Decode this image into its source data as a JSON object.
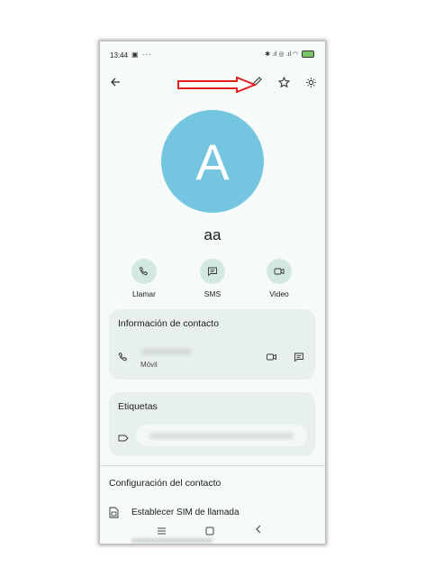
{
  "status_bar": {
    "time": "13:44",
    "notifications": "▣ ···",
    "system_icons": "✱ .ıl ◎ .ıl ◠"
  },
  "toolbar": {
    "back_icon": "arrow-left-icon",
    "edit_icon": "pencil-icon",
    "favorite_icon": "star-icon",
    "settings_icon": "contact-settings-icon",
    "annotation_color": "#e0201f"
  },
  "contact": {
    "avatar_letter": "A",
    "avatar_color": "#74c6e0",
    "name": "aa"
  },
  "actions": [
    {
      "label": "Llamar",
      "icon": "phone-icon"
    },
    {
      "label": "SMS",
      "icon": "message-icon"
    },
    {
      "label": "Video",
      "icon": "video-icon"
    }
  ],
  "contact_info": {
    "title": "Información de contacto",
    "phone_type": "Móvil"
  },
  "tags": {
    "title": "Etiquetas"
  },
  "contact_settings": {
    "title": "Configuración del contacto",
    "sim_label": "Establecer SIM de llamada"
  },
  "nav": {
    "menu_icon": "menu-icon",
    "home_icon": "home-square-icon",
    "back_icon": "back-chevron-icon"
  }
}
